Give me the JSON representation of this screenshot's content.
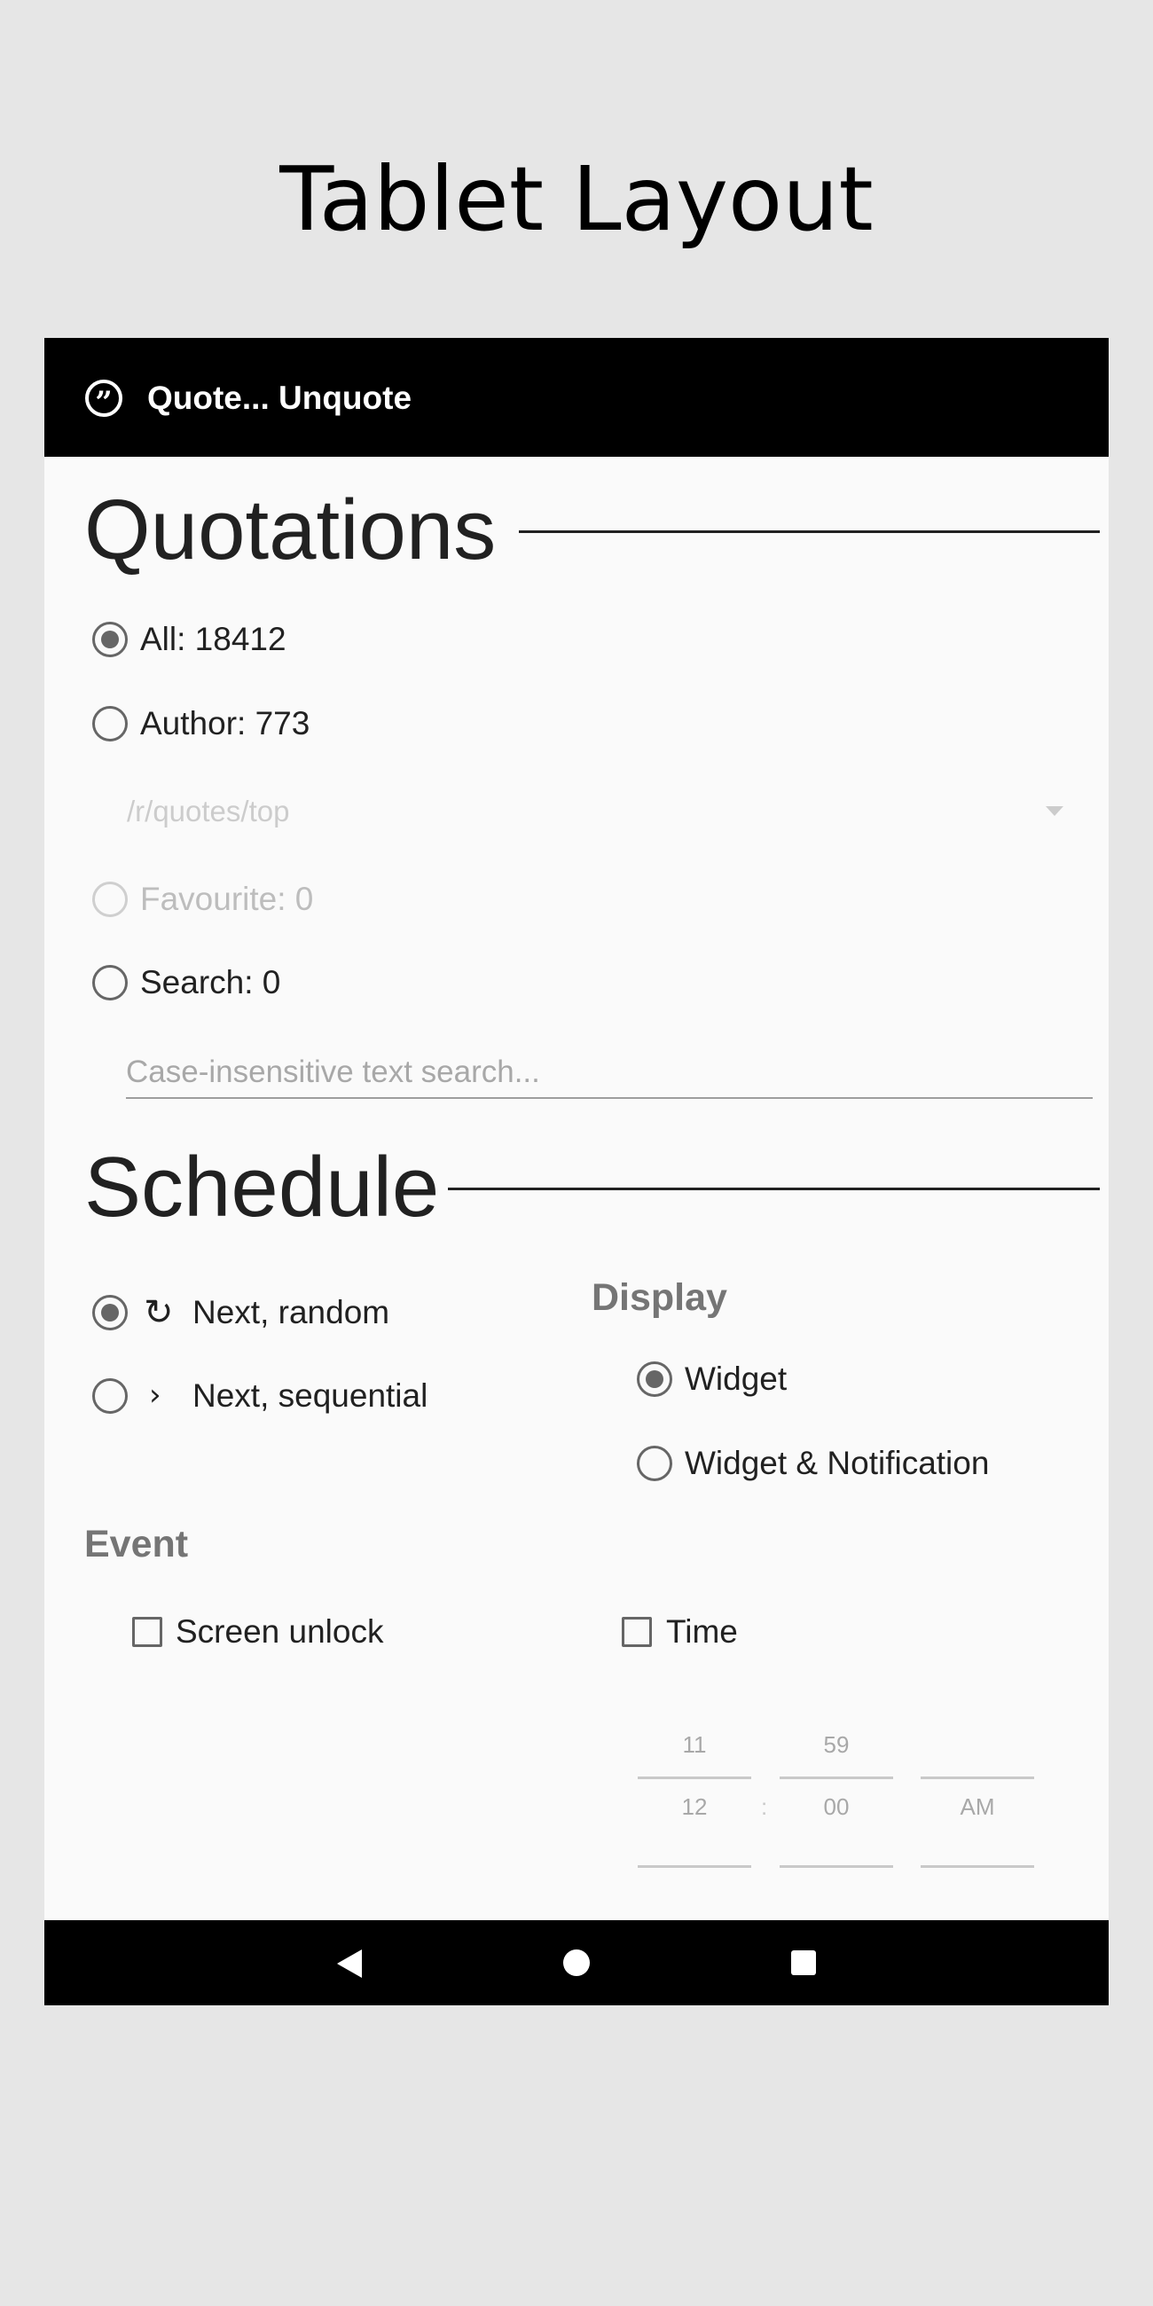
{
  "page_title": "Tablet Layout",
  "app_bar": {
    "icon": "quote-icon",
    "icon_glyph": "”",
    "title": "Quote... Unquote"
  },
  "quotations": {
    "header": "Quotations",
    "all_label": "All: 18412",
    "author_label": "Author: 773",
    "source_dropdown_value": "/r/quotes/top",
    "favourite_label": "Favourite: 0",
    "search_label": "Search: 0",
    "search_placeholder": "Case-insensitive text search..."
  },
  "schedule": {
    "header": "Schedule",
    "next_random_label": "Next, random",
    "next_random_icon": "refresh-icon",
    "next_sequential_label": "Next, sequential",
    "next_sequential_icon": "chevron-right-icon",
    "display_heading": "Display",
    "widget_label": "Widget",
    "widget_notification_label": "Widget & Notification",
    "event_heading": "Event",
    "screen_unlock_label": "Screen unlock",
    "time_label": "Time",
    "time_picker": {
      "hour_above": "11",
      "minute_above": "59",
      "hour": "12",
      "separator": ":",
      "minute": "00",
      "ampm": "AM"
    }
  },
  "nav_bar": {
    "back_icon": "back-icon",
    "home_icon": "home-icon",
    "recents_icon": "recents-icon"
  }
}
